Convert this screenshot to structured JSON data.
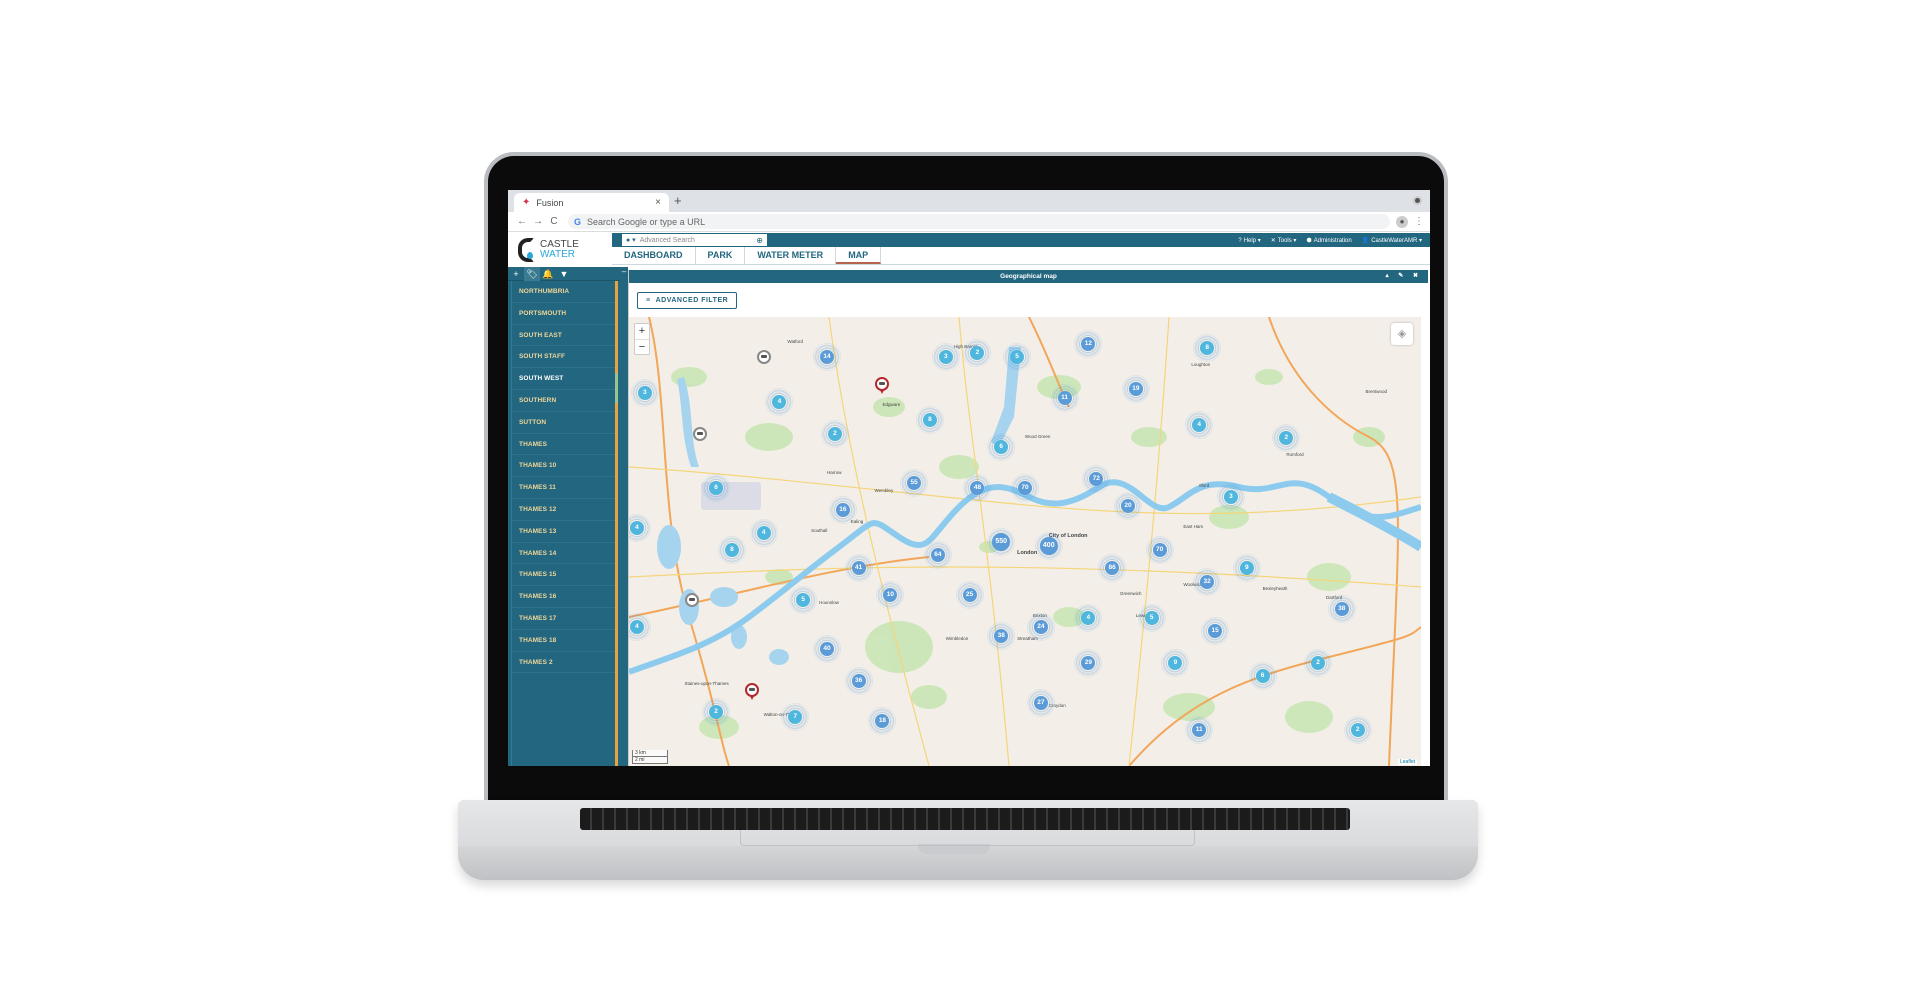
{
  "browser": {
    "tab_title": "Fusion",
    "tab_close": "×",
    "new_tab": "+",
    "omnibox_placeholder": "Search Google or type a URL",
    "back": "←",
    "forward": "→",
    "reload": "C"
  },
  "app": {
    "logo_line1": "CASTLE",
    "logo_line2": "WATER",
    "search_placeholder": "Advanced Search",
    "top_menu": [
      {
        "icon": "?",
        "label": "Help ▾"
      },
      {
        "icon": "✕",
        "label": "Tools ▾"
      },
      {
        "icon": "⬢",
        "label": "Administration"
      },
      {
        "icon": "👤",
        "label": "CastleWaterAMR ▾"
      }
    ],
    "nav_tabs": [
      {
        "label": "DASHBOARD",
        "active": false
      },
      {
        "label": "PARK",
        "active": false
      },
      {
        "label": "WATER METER",
        "active": false
      },
      {
        "label": "MAP",
        "active": true
      }
    ]
  },
  "sidebar": {
    "toolbar": [
      "+",
      "🏷",
      "🔔",
      "▼"
    ],
    "collapse_label": "–",
    "items": [
      {
        "label": "NORTHUMBRIA",
        "selected": false
      },
      {
        "label": "PORTSMOUTH",
        "selected": false
      },
      {
        "label": "SOUTH EAST",
        "selected": false
      },
      {
        "label": "SOUTH STAFF",
        "selected": false
      },
      {
        "label": "SOUTH WEST",
        "selected": true
      },
      {
        "label": "SOUTHERN",
        "selected": false
      },
      {
        "label": "SUTTON",
        "selected": false
      },
      {
        "label": "THAMES",
        "selected": false
      },
      {
        "label": "THAMES 10",
        "selected": false
      },
      {
        "label": "THAMES 11",
        "selected": false
      },
      {
        "label": "THAMES 12",
        "selected": false
      },
      {
        "label": "THAMES 13",
        "selected": false
      },
      {
        "label": "THAMES 14",
        "selected": false
      },
      {
        "label": "THAMES 15",
        "selected": false
      },
      {
        "label": "THAMES 16",
        "selected": false
      },
      {
        "label": "THAMES 17",
        "selected": false
      },
      {
        "label": "THAMES 18",
        "selected": false
      },
      {
        "label": "THAMES 2",
        "selected": false
      }
    ]
  },
  "panel": {
    "title": "Geographical map",
    "controls": "▴ ✎ ✖",
    "filter_label": "ADVANCED FILTER"
  },
  "map": {
    "zoom_in": "+",
    "zoom_out": "−",
    "scale_km": "3 km",
    "scale_mi": "2 mi",
    "attribution": "Leaflet",
    "clusters": [
      {
        "count": 14,
        "pos": [
          0.25,
          0.09
        ]
      },
      {
        "count": 3,
        "pos": [
          0.4,
          0.09
        ]
      },
      {
        "count": 3,
        "pos": [
          0.02,
          0.17
        ]
      },
      {
        "count": 4,
        "pos": [
          0.19,
          0.19
        ]
      },
      {
        "count": 2,
        "pos": [
          0.26,
          0.26
        ]
      },
      {
        "count": 8,
        "pos": [
          0.38,
          0.23
        ]
      },
      {
        "count": 6,
        "pos": [
          0.11,
          0.38
        ]
      },
      {
        "count": 4,
        "pos": [
          0.01,
          0.47
        ]
      },
      {
        "count": 4,
        "pos": [
          0.17,
          0.48
        ]
      },
      {
        "count": 16,
        "pos": [
          0.27,
          0.43
        ]
      },
      {
        "count": 55,
        "pos": [
          0.36,
          0.37
        ]
      },
      {
        "count": 41,
        "pos": [
          0.29,
          0.56
        ]
      },
      {
        "count": 10,
        "pos": [
          0.33,
          0.62
        ]
      },
      {
        "count": 64,
        "pos": [
          0.39,
          0.53
        ]
      },
      {
        "count": 8,
        "pos": [
          0.13,
          0.52
        ]
      },
      {
        "count": 5,
        "pos": [
          0.22,
          0.63
        ]
      },
      {
        "count": 4,
        "pos": [
          0.01,
          0.69
        ]
      },
      {
        "count": 40,
        "pos": [
          0.25,
          0.74
        ]
      },
      {
        "count": 36,
        "pos": [
          0.29,
          0.81
        ]
      },
      {
        "count": 2,
        "pos": [
          0.11,
          0.88
        ]
      },
      {
        "count": 7,
        "pos": [
          0.21,
          0.89
        ]
      },
      {
        "count": 18,
        "pos": [
          0.32,
          0.9
        ]
      },
      {
        "count": 2,
        "pos": [
          0.44,
          0.08
        ]
      },
      {
        "count": 5,
        "pos": [
          0.49,
          0.09
        ]
      },
      {
        "count": 12,
        "pos": [
          0.58,
          0.06
        ]
      },
      {
        "count": 11,
        "pos": [
          0.55,
          0.18
        ]
      },
      {
        "count": 19,
        "pos": [
          0.64,
          0.16
        ]
      },
      {
        "count": 8,
        "pos": [
          0.73,
          0.07
        ]
      },
      {
        "count": 4,
        "pos": [
          0.72,
          0.24
        ]
      },
      {
        "count": 6,
        "pos": [
          0.47,
          0.29
        ]
      },
      {
        "count": 48,
        "pos": [
          0.44,
          0.38
        ]
      },
      {
        "count": 70,
        "pos": [
          0.5,
          0.38
        ]
      },
      {
        "count": 72,
        "pos": [
          0.59,
          0.36
        ]
      },
      {
        "count": 20,
        "pos": [
          0.63,
          0.42
        ]
      },
      {
        "count": 550,
        "pos": [
          0.47,
          0.5
        ]
      },
      {
        "count": 400,
        "pos": [
          0.53,
          0.51
        ]
      },
      {
        "count": 86,
        "pos": [
          0.61,
          0.56
        ]
      },
      {
        "count": 70,
        "pos": [
          0.67,
          0.52
        ]
      },
      {
        "count": 32,
        "pos": [
          0.73,
          0.59
        ]
      },
      {
        "count": 25,
        "pos": [
          0.43,
          0.62
        ]
      },
      {
        "count": 4,
        "pos": [
          0.58,
          0.67
        ]
      },
      {
        "count": 5,
        "pos": [
          0.66,
          0.67
        ]
      },
      {
        "count": 2,
        "pos": [
          0.83,
          0.27
        ]
      },
      {
        "count": 3,
        "pos": [
          0.76,
          0.4
        ]
      },
      {
        "count": 9,
        "pos": [
          0.78,
          0.56
        ]
      },
      {
        "count": 38,
        "pos": [
          0.47,
          0.71
        ]
      },
      {
        "count": 24,
        "pos": [
          0.52,
          0.69
        ]
      },
      {
        "count": 29,
        "pos": [
          0.58,
          0.77
        ]
      },
      {
        "count": 27,
        "pos": [
          0.52,
          0.86
        ]
      },
      {
        "count": 15,
        "pos": [
          0.74,
          0.7
        ]
      },
      {
        "count": 9,
        "pos": [
          0.69,
          0.77
        ]
      },
      {
        "count": 6,
        "pos": [
          0.8,
          0.8
        ]
      },
      {
        "count": 2,
        "pos": [
          0.87,
          0.77
        ]
      },
      {
        "count": 38,
        "pos": [
          0.9,
          0.65
        ]
      },
      {
        "count": 11,
        "pos": [
          0.72,
          0.92
        ]
      },
      {
        "count": 2,
        "pos": [
          0.92,
          0.92
        ]
      }
    ],
    "pins": [
      {
        "type": "grey",
        "pos": [
          0.17,
          0.09
        ]
      },
      {
        "type": "red",
        "pos": [
          0.32,
          0.15
        ]
      },
      {
        "type": "grey",
        "pos": [
          0.09,
          0.26
        ]
      },
      {
        "type": "grey",
        "pos": [
          0.08,
          0.63
        ]
      },
      {
        "type": "red",
        "pos": [
          0.155,
          0.83
        ]
      }
    ],
    "places": [
      {
        "name": "Watford",
        "pos": [
          0.2,
          0.05
        ]
      },
      {
        "name": "Edgware",
        "pos": [
          0.32,
          0.19
        ]
      },
      {
        "name": "High Barnet",
        "pos": [
          0.41,
          0.06
        ]
      },
      {
        "name": "Harrow",
        "pos": [
          0.25,
          0.34
        ]
      },
      {
        "name": "Wembley",
        "pos": [
          0.31,
          0.38
        ]
      },
      {
        "name": "Southall",
        "pos": [
          0.23,
          0.47
        ]
      },
      {
        "name": "Ealing",
        "pos": [
          0.28,
          0.45
        ]
      },
      {
        "name": "Hounslow",
        "pos": [
          0.24,
          0.63
        ]
      },
      {
        "name": "Wood Green",
        "pos": [
          0.5,
          0.26
        ]
      },
      {
        "name": "Loughton",
        "pos": [
          0.71,
          0.1
        ]
      },
      {
        "name": "Romford",
        "pos": [
          0.83,
          0.3
        ]
      },
      {
        "name": "Brentwood",
        "pos": [
          0.93,
          0.16
        ]
      },
      {
        "name": "Ilford",
        "pos": [
          0.72,
          0.37
        ]
      },
      {
        "name": "East Ham",
        "pos": [
          0.7,
          0.46
        ]
      },
      {
        "name": "City of London",
        "pos": [
          0.53,
          0.48
        ]
      },
      {
        "name": "London",
        "pos": [
          0.49,
          0.52
        ]
      },
      {
        "name": "Woolwich",
        "pos": [
          0.7,
          0.59
        ]
      },
      {
        "name": "Greenwich",
        "pos": [
          0.62,
          0.61
        ]
      },
      {
        "name": "Lewisham",
        "pos": [
          0.64,
          0.66
        ]
      },
      {
        "name": "Bexleyheath",
        "pos": [
          0.8,
          0.6
        ]
      },
      {
        "name": "Dartford",
        "pos": [
          0.88,
          0.62
        ]
      },
      {
        "name": "Brixton",
        "pos": [
          0.51,
          0.66
        ]
      },
      {
        "name": "Streatham",
        "pos": [
          0.49,
          0.71
        ]
      },
      {
        "name": "Wimbledon",
        "pos": [
          0.4,
          0.71
        ]
      },
      {
        "name": "Croydon",
        "pos": [
          0.53,
          0.86
        ]
      },
      {
        "name": "Walton-on-Thames",
        "pos": [
          0.17,
          0.88
        ]
      },
      {
        "name": "Staines-upon-Thames",
        "pos": [
          0.07,
          0.81
        ]
      }
    ]
  }
}
